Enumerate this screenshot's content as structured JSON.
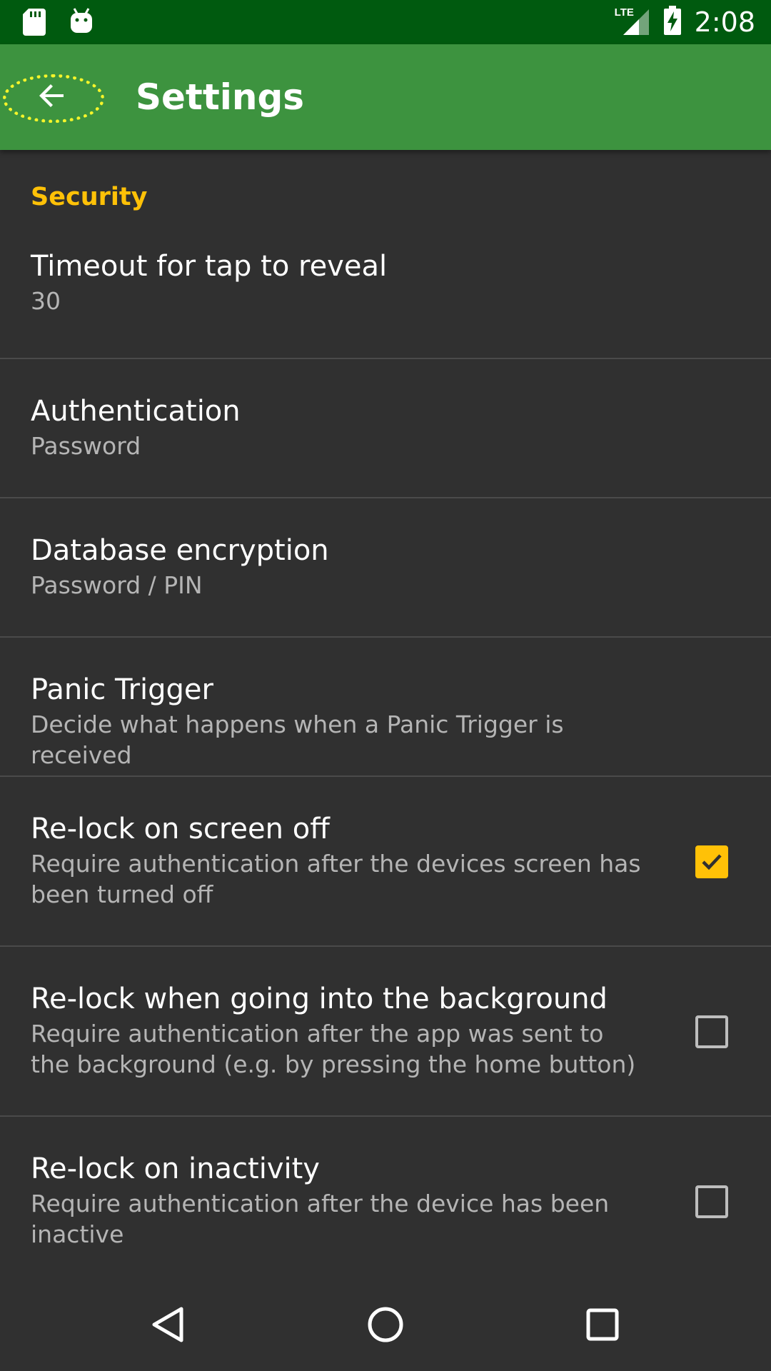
{
  "status_bar": {
    "time": "2:08",
    "network": "LTE",
    "icons": [
      "sd-card-icon",
      "android-icon",
      "lte-signal-icon",
      "battery-charging-icon"
    ]
  },
  "app_bar": {
    "title": "Settings",
    "back_icon": "arrow-back-icon"
  },
  "section": {
    "title": "Security"
  },
  "preferences": [
    {
      "title": "Timeout for tap to reveal",
      "summary": "30"
    },
    {
      "title": "Authentication",
      "summary": "Password"
    },
    {
      "title": "Database encryption",
      "summary": "Password / PIN"
    },
    {
      "title": "Panic Trigger",
      "summary": "Decide what happens when a Panic Trigger is received"
    },
    {
      "title": "Re-lock on screen off",
      "summary": "Require authentication after the devices screen has been turned off",
      "checked": true
    },
    {
      "title": "Re-lock when going into the background",
      "summary": "Require authentication after the app was sent to the background (e.g. by pressing the home button)",
      "checked": false
    },
    {
      "title": "Re-lock on inactivity",
      "summary": "Require authentication after the device has been inactive",
      "checked": false
    }
  ],
  "nav_bar": {
    "icons": [
      "back-triangle-icon",
      "home-circle-icon",
      "recents-square-icon"
    ]
  },
  "colors": {
    "status_bar": "#005a0f",
    "app_bar": "#3d933f",
    "background": "#303030",
    "accent": "#ffc107"
  }
}
